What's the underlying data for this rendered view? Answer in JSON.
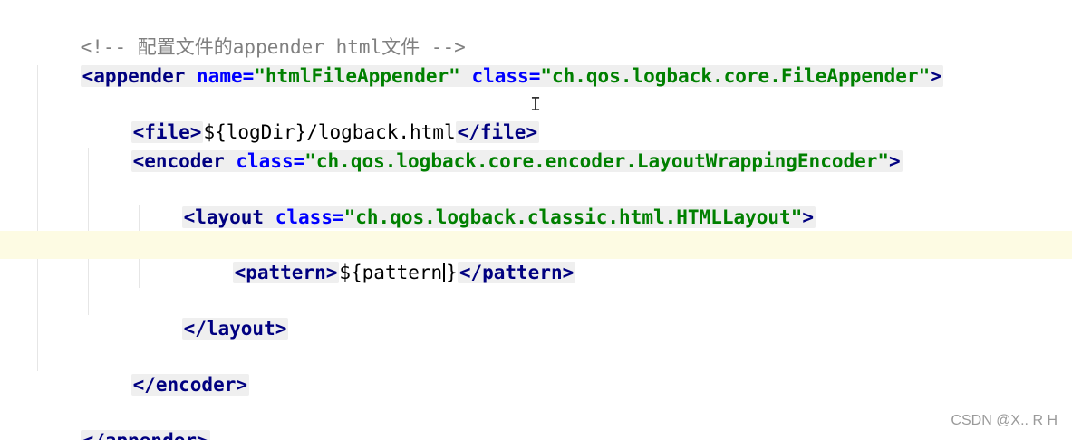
{
  "editor": {
    "comment": "<!-- 配置文件的appender html文件 -->",
    "appender_open": {
      "tag": "<appender",
      "attr1": "name=",
      "val1": "\"htmlFileAppender\"",
      "attr2": "class=",
      "val2": "\"ch.qos.logback.core.FileAppender\"",
      "close": ">"
    },
    "file": {
      "open": "<file>",
      "text": "${logDir}/logback.html",
      "close": "</file>"
    },
    "encoder_open": {
      "tag": "<encoder",
      "attr": "class=",
      "val": "\"ch.qos.logback.core.encoder.LayoutWrappingEncoder\"",
      "close": ">"
    },
    "layout_open": {
      "tag": "<layout",
      "attr": "class=",
      "val": "\"ch.qos.logback.classic.html.HTMLLayout\"",
      "close": ">"
    },
    "pattern": {
      "open": "<pattern>",
      "text_before_caret": "${pattern",
      "text_after_caret": "}",
      "close": "</pattern>"
    },
    "layout_close": "</layout>",
    "encoder_close": "</encoder>",
    "appender_close": "</appender>",
    "ibeam_glyph": "I"
  },
  "watermark": "CSDN @X.. R H"
}
